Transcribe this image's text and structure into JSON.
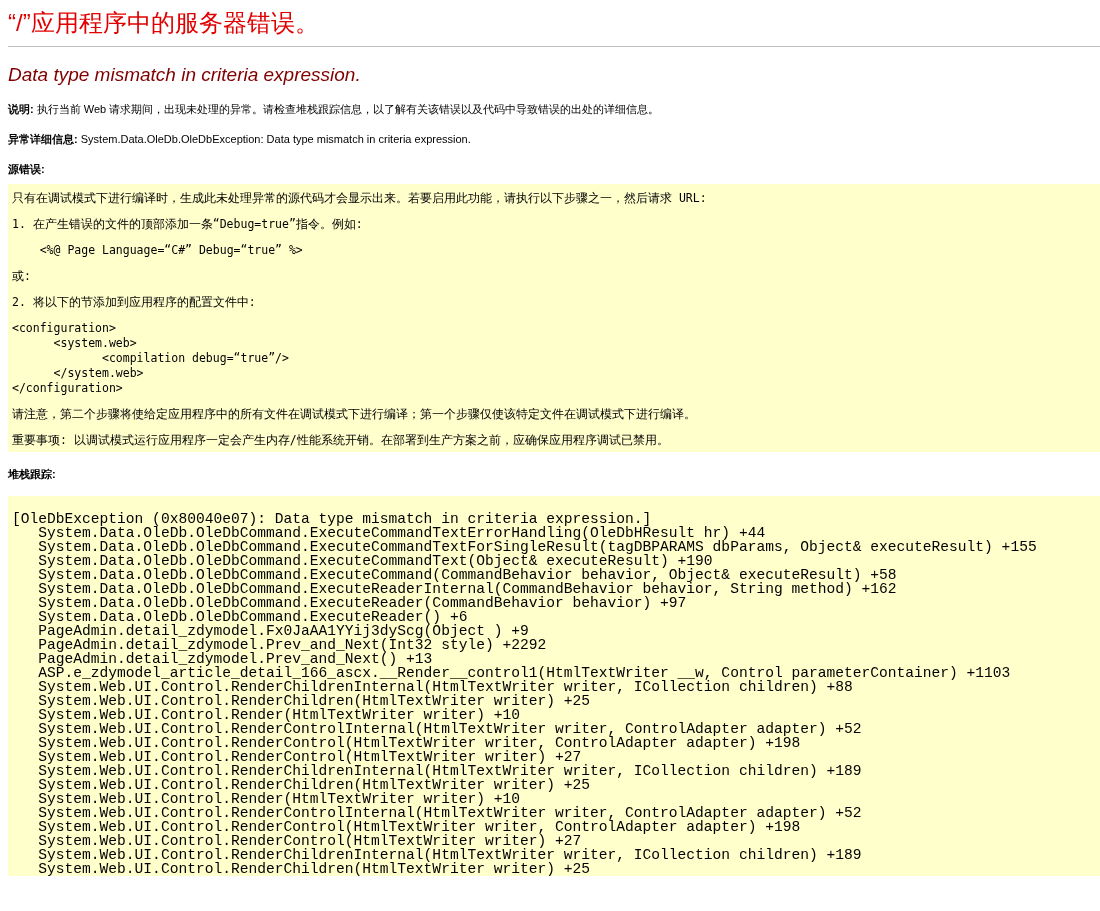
{
  "page_title": "“/”应用程序中的服务器错误。",
  "error_message": "Data type mismatch in criteria expression.",
  "details": [
    {
      "label": "说明:",
      "text": "执行当前 Web 请求期间，出现未处理的异常。请检查堆栈跟踪信息，以了解有关该错误以及代码中导致错误的出处的详细信息。"
    },
    {
      "label": "异常详细信息:",
      "text": "System.Data.OleDb.OleDbException: Data type mismatch in criteria expression."
    }
  ],
  "source_error": {
    "heading": "源错误:",
    "blocks": [
      {
        "kind": "para",
        "lines": [
          "只有在调试模式下进行编译时，生成此未处理异常的源代码才会显示出来。若要启用此功能，请执行以下步骤之一，然后请求 URL:"
        ]
      },
      {
        "kind": "para",
        "lines": [
          "1. 在产生错误的文件的顶部添加一条“Debug=true”指令。例如:"
        ]
      },
      {
        "kind": "para",
        "lines": [
          "    <%@ Page Language=“C#” Debug=“true” %>"
        ]
      },
      {
        "kind": "para",
        "lines": [
          "或:"
        ]
      },
      {
        "kind": "para",
        "lines": [
          "2. 将以下的节添加到应用程序的配置文件中:"
        ]
      },
      {
        "kind": "code",
        "lines": [
          "<configuration>",
          "      <system.web>",
          "             <compilation debug=“true”/>",
          "      </system.web>",
          "</configuration>"
        ]
      },
      {
        "kind": "para",
        "lines": [
          "请注意，第二个步骤将使给定应用程序中的所有文件在调试模式下进行编译；第一个步骤仅使该特定文件在调试模式下进行编译。"
        ]
      },
      {
        "kind": "para",
        "lines": [
          "重要事项: 以调试模式运行应用程序一定会产生内存/性能系统开销。在部署到生产方案之前，应确保应用程序调试已禁用。"
        ]
      }
    ]
  },
  "stack_trace": {
    "heading": "堆栈跟踪:",
    "lines": [
      "[OleDbException (0x80040e07): Data type mismatch in criteria expression.]",
      "   System.Data.OleDb.OleDbCommand.ExecuteCommandTextErrorHandling(OleDbHResult hr) +44",
      "   System.Data.OleDb.OleDbCommand.ExecuteCommandTextForSingleResult(tagDBPARAMS dbParams, Object& executeResult) +155",
      "   System.Data.OleDb.OleDbCommand.ExecuteCommandText(Object& executeResult) +190",
      "   System.Data.OleDb.OleDbCommand.ExecuteCommand(CommandBehavior behavior, Object& executeResult) +58",
      "   System.Data.OleDb.OleDbCommand.ExecuteReaderInternal(CommandBehavior behavior, String method) +162",
      "   System.Data.OleDb.OleDbCommand.ExecuteReader(CommandBehavior behavior) +97",
      "   System.Data.OleDb.OleDbCommand.ExecuteReader() +6",
      "   PageAdmin.detail_zdymodel.Fx0JaAA1YYij3dyScg(Object ) +9",
      "   PageAdmin.detail_zdymodel.Prev_and_Next(Int32 style) +2292",
      "   PageAdmin.detail_zdymodel.Prev_and_Next() +13",
      "   ASP.e_zdymodel_article_detail_166_ascx.__Render__control1(HtmlTextWriter __w, Control parameterContainer) +1103",
      "   System.Web.UI.Control.RenderChildrenInternal(HtmlTextWriter writer, ICollection children) +88",
      "   System.Web.UI.Control.RenderChildren(HtmlTextWriter writer) +25",
      "   System.Web.UI.Control.Render(HtmlTextWriter writer) +10",
      "   System.Web.UI.Control.RenderControlInternal(HtmlTextWriter writer, ControlAdapter adapter) +52",
      "   System.Web.UI.Control.RenderControl(HtmlTextWriter writer, ControlAdapter adapter) +198",
      "   System.Web.UI.Control.RenderControl(HtmlTextWriter writer) +27",
      "   System.Web.UI.Control.RenderChildrenInternal(HtmlTextWriter writer, ICollection children) +189",
      "   System.Web.UI.Control.RenderChildren(HtmlTextWriter writer) +25",
      "   System.Web.UI.Control.Render(HtmlTextWriter writer) +10",
      "   System.Web.UI.Control.RenderControlInternal(HtmlTextWriter writer, ControlAdapter adapter) +52",
      "   System.Web.UI.Control.RenderControl(HtmlTextWriter writer, ControlAdapter adapter) +198",
      "   System.Web.UI.Control.RenderControl(HtmlTextWriter writer) +27",
      "   System.Web.UI.Control.RenderChildrenInternal(HtmlTextWriter writer, ICollection children) +189",
      "   System.Web.UI.Control.RenderChildren(HtmlTextWriter writer) +25"
    ]
  }
}
